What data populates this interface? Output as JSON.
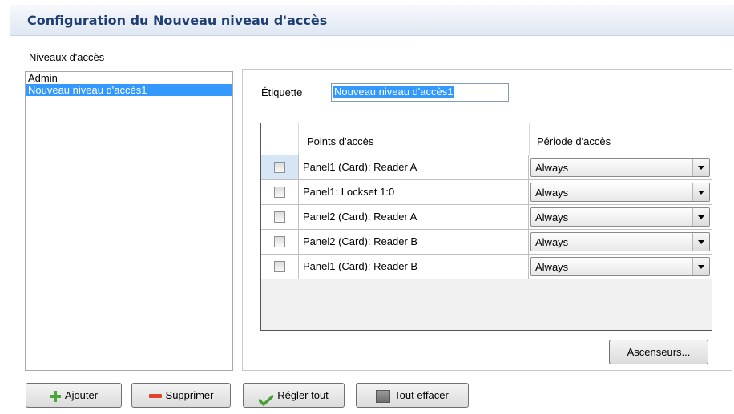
{
  "header": {
    "title": "Configuration du Nouveau niveau d'accès"
  },
  "levels": {
    "label": "Niveaux d'accès",
    "items": [
      {
        "label": "Admin"
      },
      {
        "label": "Nouveau niveau d'accès1"
      }
    ]
  },
  "etiquette": {
    "label": "Étiquette",
    "value": "Nouveau niveau d'accès1"
  },
  "grid": {
    "columns": [
      "Points d'accès",
      "Période d'accès"
    ],
    "rows": [
      {
        "access_point": "Panel1 (Card): Reader A",
        "period": "Always"
      },
      {
        "access_point": "Panel1: Lockset 1:0",
        "period": "Always"
      },
      {
        "access_point": "Panel2 (Card): Reader A",
        "period": "Always"
      },
      {
        "access_point": "Panel2 (Card): Reader B",
        "period": "Always"
      },
      {
        "access_point": "Panel1 (Card): Reader B",
        "period": "Always"
      }
    ]
  },
  "buttons": {
    "elevators": "Ascenseurs...",
    "add_first": "A",
    "add_rest": "jouter",
    "delete_first": "S",
    "delete_rest": "upprimer",
    "set_all_first": "R",
    "set_all_rest": "égler tout",
    "clear_all_first": "T",
    "clear_all_rest": "out effacer"
  },
  "icons": {
    "add": "plus-icon",
    "delete": "minus-icon",
    "set_all": "check-icon",
    "clear_all": "erase-icon"
  },
  "colors": {
    "title": "#1f3f74",
    "selection": "#3399ff",
    "add_icon": "#49a83a",
    "delete_icon": "#e0452b"
  }
}
